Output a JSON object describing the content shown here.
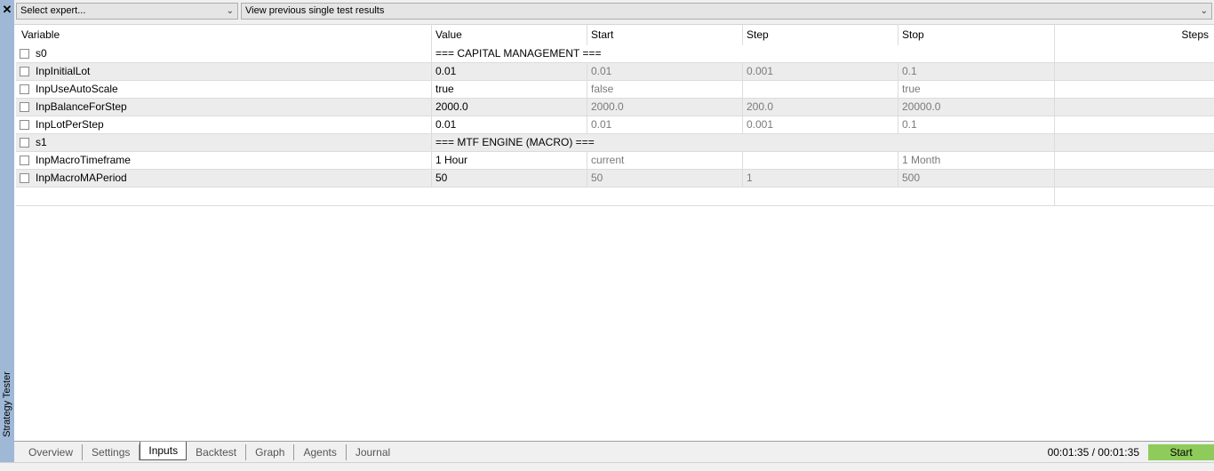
{
  "side": {
    "close_icon": "✕",
    "label": "Strategy Tester"
  },
  "toolbar": {
    "expert_select": "Select expert...",
    "results_select": "View previous single test results"
  },
  "columns": {
    "variable": "Variable",
    "value": "Value",
    "start": "Start",
    "step": "Step",
    "stop": "Stop",
    "steps": "Steps"
  },
  "rows": [
    {
      "type": "group",
      "name": "s0",
      "title": "=== CAPITAL MANAGEMENT ==="
    },
    {
      "type": "param",
      "name": "InpInitialLot",
      "value": "0.01",
      "start": "0.01",
      "step": "0.001",
      "stop": "0.1"
    },
    {
      "type": "param",
      "name": "InpUseAutoScale",
      "value": "true",
      "start": "false",
      "step": "",
      "stop": "true"
    },
    {
      "type": "param",
      "name": "InpBalanceForStep",
      "value": "2000.0",
      "start": "2000.0",
      "step": "200.0",
      "stop": "20000.0"
    },
    {
      "type": "param",
      "name": "InpLotPerStep",
      "value": "0.01",
      "start": "0.01",
      "step": "0.001",
      "stop": "0.1"
    },
    {
      "type": "group",
      "name": "s1",
      "title": "=== MTF ENGINE (MACRO) ==="
    },
    {
      "type": "param",
      "name": "InpMacroTimeframe",
      "value": "1 Hour",
      "start": "current",
      "step": "",
      "stop": "1 Month"
    },
    {
      "type": "param",
      "name": "InpMacroMAPeriod",
      "value": "50",
      "start": "50",
      "step": "1",
      "stop": "500"
    }
  ],
  "tabs": [
    "Overview",
    "Settings",
    "Inputs",
    "Backtest",
    "Graph",
    "Agents",
    "Journal"
  ],
  "active_tab": "Inputs",
  "timer": "00:01:35 / 00:01:35",
  "start_button": "Start",
  "colors": {
    "sidebar": "#9eb8d6",
    "start_button": "#8ecb5a",
    "row_alt": "#ececec"
  }
}
